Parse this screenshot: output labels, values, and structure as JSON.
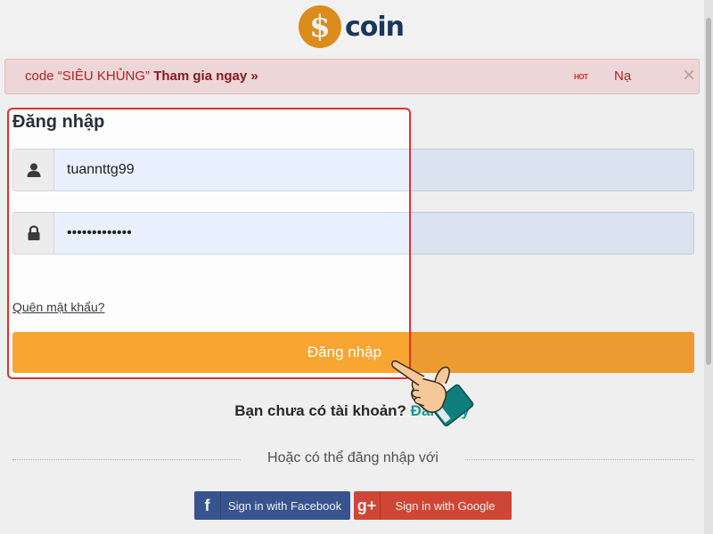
{
  "header": {
    "logo_symbol": "$",
    "logo_text": "coin"
  },
  "banner": {
    "promo_prefix": "code “SIÊU KHỦNG”",
    "promo_link": "Tham gia ngay »",
    "hot_badge": "HOT",
    "promo_next": "Nạ",
    "close_symbol": "×"
  },
  "login": {
    "title": "Đăng nhập",
    "username_value": "tuannttg99",
    "password_value": "•••••••••••••",
    "forgot_label": "Quên mật khẩu?",
    "submit_label": "Đăng nhập"
  },
  "register": {
    "prompt": "Bạn chưa có tài khoản?",
    "link_label": "Đăng ký"
  },
  "alt_login": {
    "text": "Hoặc có thể đăng nhập với",
    "facebook_icon": "f",
    "facebook_label": "Sign in with Facebook",
    "google_icon": "g+",
    "google_label": "Sign in with Google"
  },
  "colors": {
    "accent_orange": "#f9a532",
    "brand_navy": "#1c3a63",
    "highlight_red": "#e2302c",
    "link_teal": "#1a9fa0",
    "facebook_blue": "#3b5998",
    "google_red": "#dd4b39"
  },
  "icons": {
    "username": "user-icon",
    "password": "lock-icon",
    "pointer": "hand-pointer-icon"
  }
}
